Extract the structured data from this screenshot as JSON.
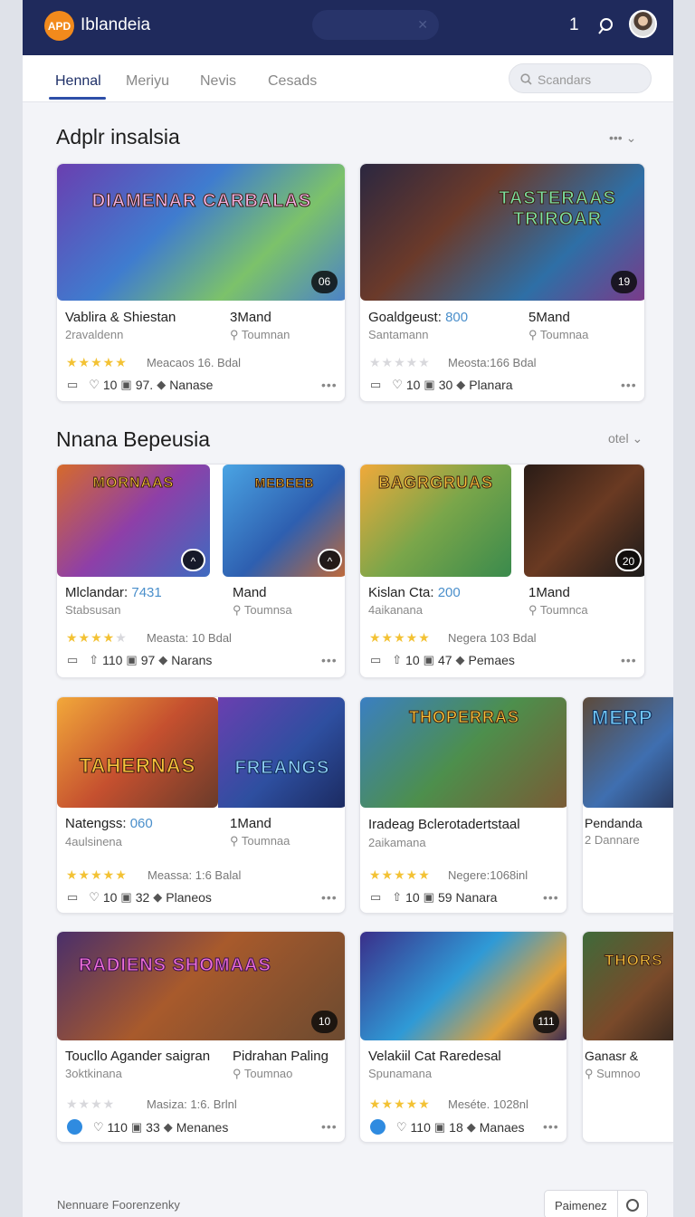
{
  "app": {
    "logo_text": "APD",
    "name": "Iblandeia",
    "notification_count": "1",
    "top_search_clear": "✕"
  },
  "nav": {
    "tabs": [
      {
        "label": "Hennal",
        "active": true
      },
      {
        "label": "Meriyu"
      },
      {
        "label": "Nevis"
      },
      {
        "label": "Cesads"
      }
    ],
    "search_placeholder": "Scandars"
  },
  "sections": [
    {
      "title": "Adplr insalsia",
      "controls": "••• ⌄"
    },
    {
      "title": "Nnana Bepeusia",
      "controls": "otel ⌄"
    }
  ],
  "cards": [
    {
      "art_title": "DIAMENAR CARBALAS",
      "badge": "06",
      "title": "Vablira & Shiestan",
      "title_num": "",
      "side_title": "3Mand",
      "subtitle": "2ravaldenn",
      "side_sub": "⚲ Toumnan",
      "rating": 5,
      "meta": "Meacaos 16. Bdal",
      "likes": "10",
      "comments": "97.",
      "tag": "Nanase"
    },
    {
      "art_title": "TASTERAAS TRIROAR",
      "badge": "19",
      "title": "Goaldgeust:",
      "title_num": "800",
      "side_title": "5Mand",
      "subtitle": "Santamann",
      "side_sub": "⚲ Toumnaa",
      "rating": 0,
      "meta": "Meosta:166 Bdal",
      "likes": "10",
      "comments": "30",
      "tag": "Planara"
    },
    {
      "art_title": "MORNAAS",
      "art2_title": "MEBEEB",
      "badge": "",
      "title": "Mlclandar:",
      "title_num": "7431",
      "side_title": "Mand",
      "subtitle": "Stabsusan",
      "side_sub": "⚲ Toumnsa",
      "rating": 4,
      "meta": "Measta: 10 Bdal",
      "likes": "110",
      "comments": "97",
      "tag": "Narans"
    },
    {
      "art_title": "BAGRGRUAS",
      "badge": "20",
      "title": "Kislan Cta:",
      "title_num": "200",
      "side_title": "1Mand",
      "subtitle": "4aikanana",
      "side_sub": "⚲ Toumnca",
      "rating": 5,
      "meta": "Negera 103 Bdal",
      "likes": "10",
      "comments": "47",
      "tag": "Pemaes"
    },
    {
      "art_title": "TAHERNAS",
      "art2_title": "FREANGS",
      "badge": "",
      "title": "Natengss:",
      "title_num": "060",
      "side_title": "1Mand",
      "subtitle": "4aulsinena",
      "side_sub": "⚲ Toumnaa",
      "rating": 5,
      "meta": "Meassa: 1:6 Balal",
      "likes": "10",
      "comments": "32",
      "tag": "Planeos"
    },
    {
      "art_title": "THOPERRAS",
      "badge": "",
      "title": "Iradeag Bclerotadertstaal",
      "title_num": "",
      "side_title": "",
      "subtitle": "2aikamana",
      "side_sub": "",
      "rating": 5,
      "meta": "Negere:1068inl",
      "likes": "10",
      "comments": "59",
      "tag": "Nanara"
    },
    {
      "art_title": "MERP",
      "badge": "",
      "title": "Pendanda",
      "title_num": "",
      "side_title": "",
      "subtitle": "2 Dannare",
      "side_sub": "",
      "rating": 0,
      "meta": "",
      "likes": "",
      "comments": "",
      "tag": ""
    },
    {
      "art_title": "RADIENS SHOMAAS",
      "badge": "10",
      "title": "Toucllo Agander saigran",
      "title_num": "",
      "side_title": "Pidrahan Paling",
      "subtitle": "3oktkinana",
      "side_sub": "⚲ Toumnao",
      "rating": 0,
      "meta": "Masiza: 1:6. Brlnl",
      "likes": "110",
      "comments": "33",
      "tag": "Menanes"
    },
    {
      "art_title": "",
      "badge": "111",
      "title": "Velakiil Cat Raredesal",
      "title_num": "",
      "side_title": "",
      "subtitle": "Spunamana",
      "side_sub": "",
      "rating": 5,
      "meta": "Meséte. 1028nl",
      "likes": "110",
      "comments": "18",
      "tag": "Manaes"
    },
    {
      "art_title": "THORS",
      "badge": "",
      "title": "Ganasr &",
      "title_num": "",
      "side_title": "",
      "subtitle": "⚲ Sumnoo",
      "side_sub": "",
      "rating": 0,
      "meta": "",
      "likes": "",
      "comments": "",
      "tag": ""
    }
  ],
  "footer": {
    "text": "Nennuare Foorenzenky",
    "button_label": "Paimenez"
  }
}
